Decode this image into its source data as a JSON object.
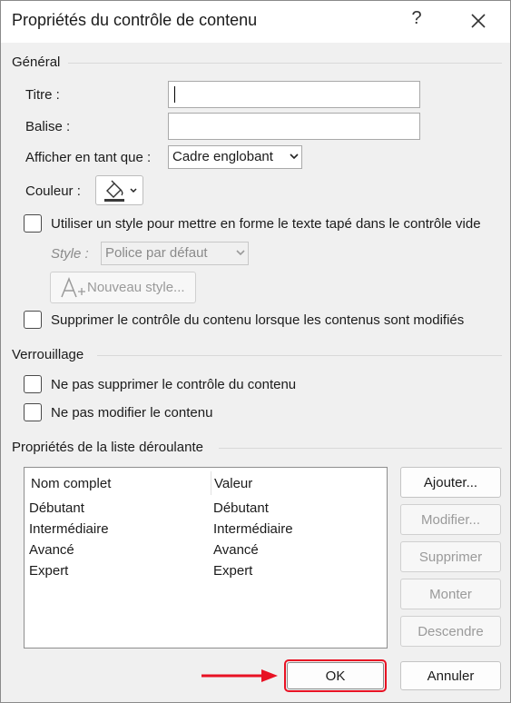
{
  "window": {
    "title": "Propriétés du contrôle de contenu",
    "help": "?",
    "close": "✕"
  },
  "general": {
    "section_label": "Général",
    "title_label": "Titre :",
    "title_value": "",
    "tag_label": "Balise :",
    "tag_value": "",
    "show_as_label": "Afficher en tant que :",
    "show_as_value": "Cadre englobant",
    "color_label": "Couleur :",
    "use_style_label": "Utiliser un style pour mettre en forme le texte tapé dans le contrôle vide",
    "style_label": "Style :",
    "style_value": "Police par défaut",
    "new_style_label": "Nouveau style...",
    "remove_when_edited_label": "Supprimer le contrôle du contenu lorsque les contenus sont modifiés"
  },
  "locking": {
    "section_label": "Verrouillage",
    "no_delete_label": "Ne pas supprimer le contrôle du contenu",
    "no_edit_label": "Ne pas modifier le contenu"
  },
  "dropdown": {
    "section_label": "Propriétés de la liste déroulante",
    "columns": [
      "Nom complet",
      "Valeur"
    ],
    "rows": [
      {
        "name": "Débutant",
        "value": "Débutant"
      },
      {
        "name": "Intermédiaire",
        "value": "Intermédiaire"
      },
      {
        "name": "Avancé",
        "value": "Avancé"
      },
      {
        "name": "Expert",
        "value": "Expert"
      }
    ],
    "add_label": "Ajouter...",
    "modify_label": "Modifier...",
    "delete_label": "Supprimer",
    "up_label": "Monter",
    "down_label": "Descendre"
  },
  "footer": {
    "ok_label": "OK",
    "cancel_label": "Annuler"
  },
  "colors": {
    "highlight": "#e81123",
    "arrow": "#e81123"
  }
}
